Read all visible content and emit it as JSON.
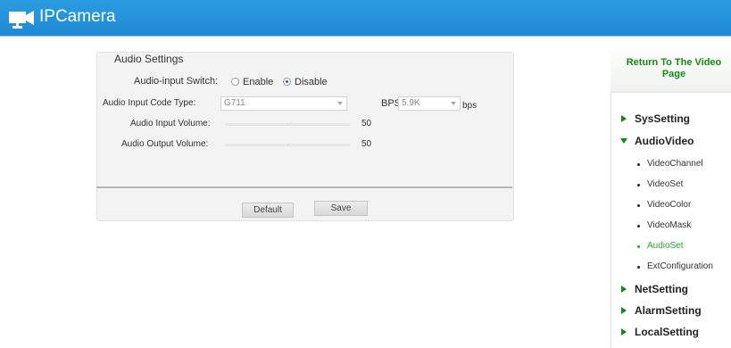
{
  "app": {
    "title": "IPCamera"
  },
  "audio_settings": {
    "title": "Audio Settings",
    "input_switch_label": "Audio-input Switch:",
    "enable_label": "Enable",
    "disable_label": "Disable",
    "selected": "Disable",
    "code_type_label": "Audio Input Code Type:",
    "code_type_value": "G711",
    "bps_label": "BPS:",
    "bps_value": "5.9K",
    "bps_unit": "bps",
    "input_volume_label": "Audio Input Volume:",
    "input_volume_value": "50",
    "output_volume_label": "Audio Output Volume:",
    "output_volume_value": "50"
  },
  "buttons": {
    "default_label": "Default",
    "save_label": "Save"
  },
  "sidebar": {
    "return_label": "Return To The Video Page",
    "sections": [
      {
        "label": "SysSetting",
        "expanded": false
      },
      {
        "label": "AudioVideo",
        "expanded": true
      },
      {
        "label": "NetSetting",
        "expanded": false
      },
      {
        "label": "AlarmSetting",
        "expanded": false
      },
      {
        "label": "LocalSetting",
        "expanded": false
      }
    ],
    "subitems": [
      {
        "label": "VideoChannel",
        "active": false
      },
      {
        "label": "VideoSet",
        "active": false
      },
      {
        "label": "VideoColor",
        "active": false
      },
      {
        "label": "VideoMask",
        "active": false
      },
      {
        "label": "AudioSet",
        "active": true
      },
      {
        "label": "ExtConfiguration",
        "active": false
      }
    ]
  },
  "colors": {
    "header": "#1f8ad4",
    "nav_accent": "#178817",
    "active_link": "#2aa52a"
  }
}
